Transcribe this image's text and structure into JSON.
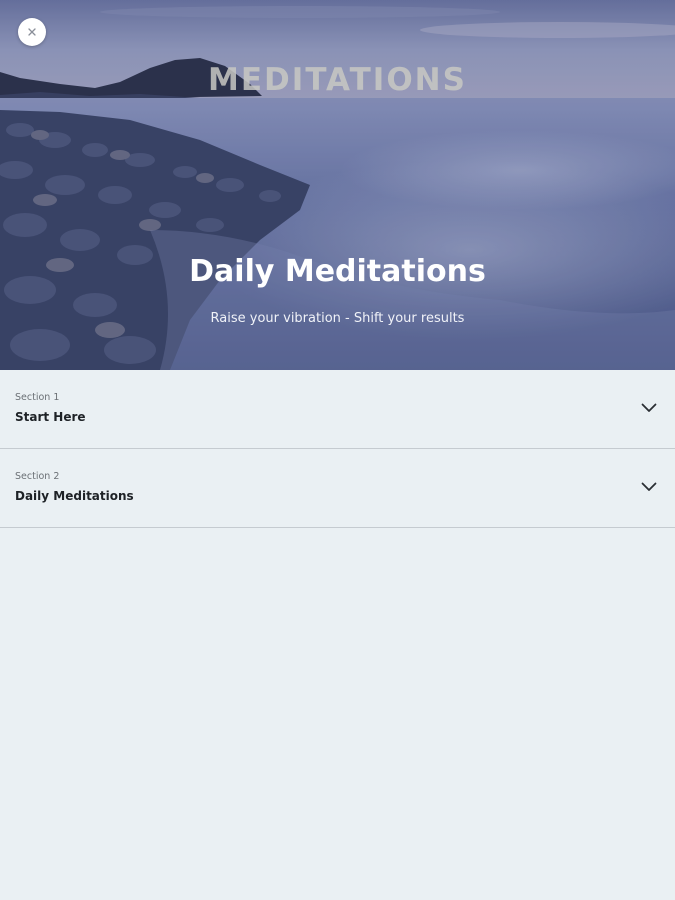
{
  "hero": {
    "brand": "MEDITATIONS",
    "title": "Daily Meditations",
    "subtitle": "Raise your vibration - Shift your results",
    "close_icon": "close-icon"
  },
  "sections": [
    {
      "label": "Section 1",
      "title": "Start Here",
      "icon": "chevron-down-icon"
    },
    {
      "label": "Section 2",
      "title": "Daily Meditations",
      "icon": "chevron-down-icon"
    }
  ],
  "colors": {
    "background": "#eaf0f3",
    "divider": "#c5cbd0",
    "title_text": "#1e2226"
  }
}
